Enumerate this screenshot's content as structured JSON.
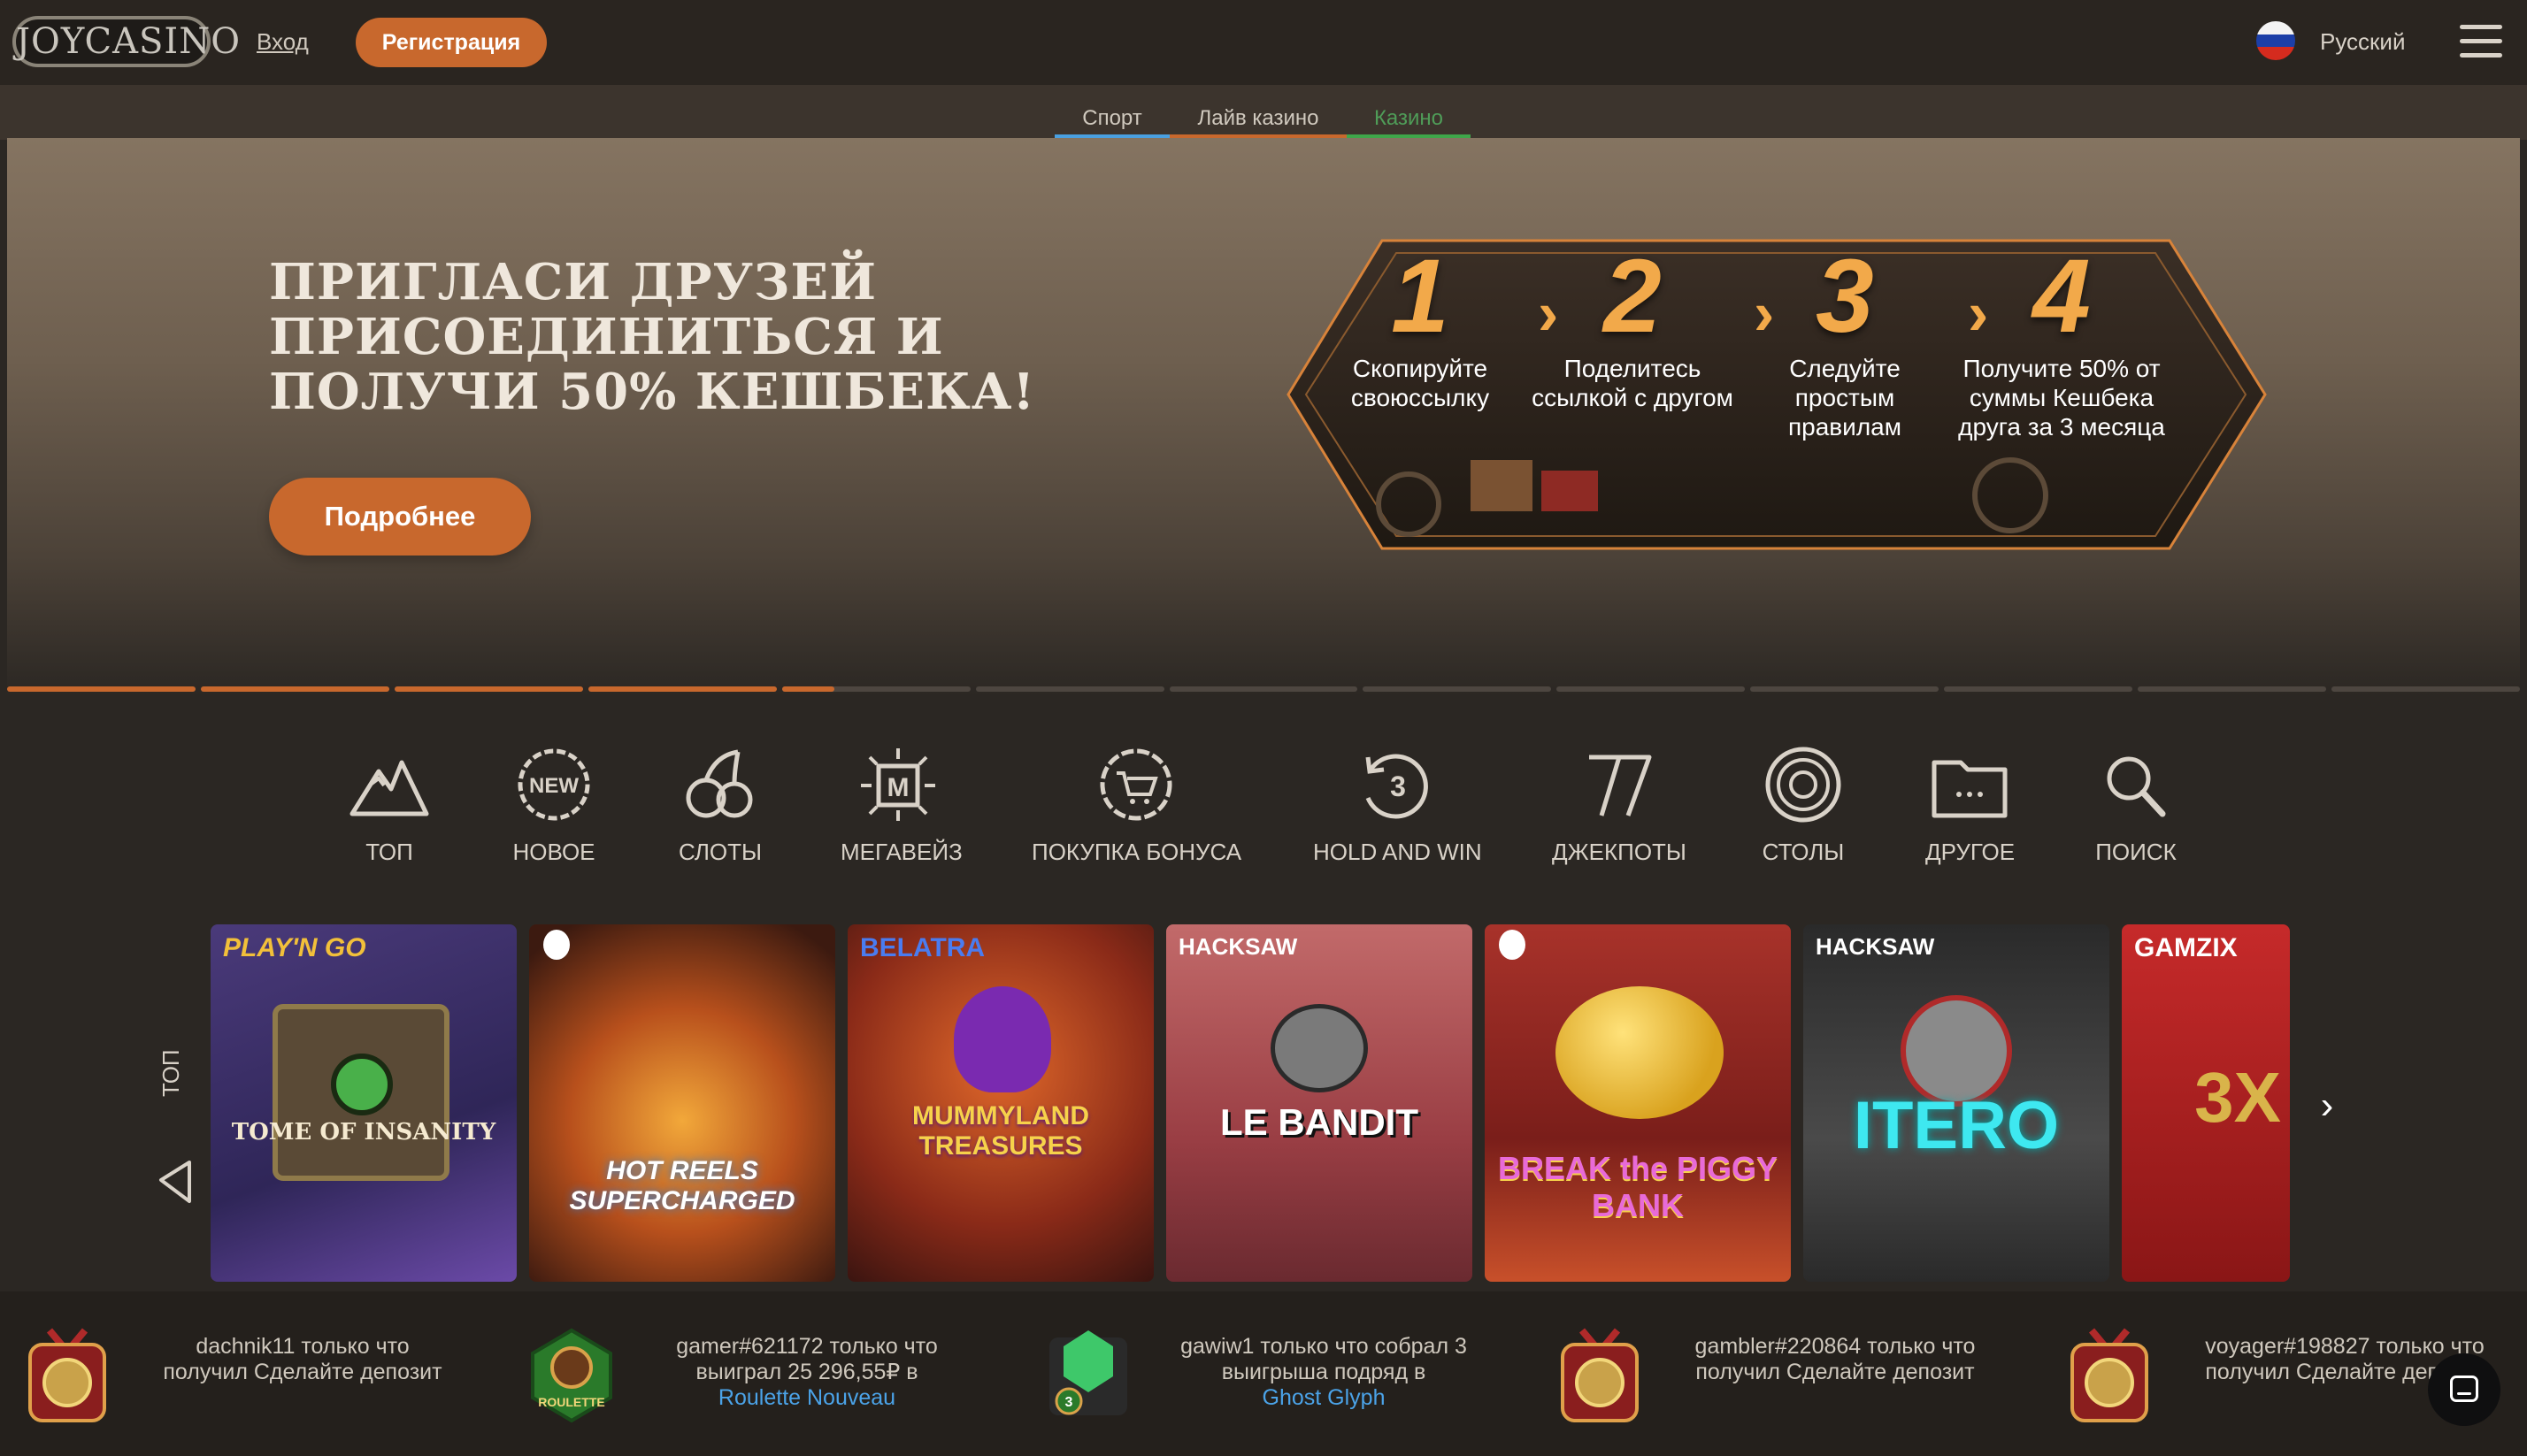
{
  "header": {
    "logo_text": "JOYCASINO",
    "login_label": "Вход",
    "register_label": "Регистрация",
    "language": "Русский"
  },
  "subnav": {
    "tabs": [
      {
        "label": "Спорт",
        "color": "#4aa0e0"
      },
      {
        "label": "Лайв казино",
        "color": "#c8682d"
      },
      {
        "label": "Казино",
        "color": "#3fa64a"
      }
    ]
  },
  "banner": {
    "title": "ПРИГЛАСИ ДРУЗЕЙ ПРИСОЕДИНИТЬСЯ И ПОЛУЧИ 50% КЕШБЕКА!",
    "button_label": "Подробнее",
    "steps": [
      {
        "num": "1",
        "text": "Скопируйте своюссылку"
      },
      {
        "num": "2",
        "text": "Поделитесь ссылкой с другом"
      },
      {
        "num": "3",
        "text": "Следуйте простым правилам"
      },
      {
        "num": "4",
        "text": "Получите 50% от суммы Кешбека друга за 3 месяца"
      }
    ],
    "slides_total": 13,
    "active_slide": 4
  },
  "categories": [
    {
      "label": "ТОП",
      "icon": "mountain-icon"
    },
    {
      "label": "НОВОЕ",
      "icon": "new-badge-icon"
    },
    {
      "label": "СЛОТЫ",
      "icon": "cherries-icon"
    },
    {
      "label": "МЕГАВЕЙЗ",
      "icon": "megaways-icon"
    },
    {
      "label": "ПОКУПКА БОНУСА",
      "icon": "bonus-cart-icon"
    },
    {
      "label": "HOLD AND WIN",
      "icon": "hold-and-win-icon"
    },
    {
      "label": "ДЖЕКПОТЫ",
      "icon": "seven-icon"
    },
    {
      "label": "СТОЛЫ",
      "icon": "roulette-icon"
    },
    {
      "label": "ДРУГОЕ",
      "icon": "folder-icon"
    },
    {
      "label": "ПОИСК",
      "icon": "search-icon"
    }
  ],
  "games_section": {
    "label": "ТОП",
    "games": [
      {
        "provider": "PLAY'N GO",
        "name": "TOME OF INSANITY"
      },
      {
        "provider": "",
        "name": "HOT REELS SUPERCHARGED"
      },
      {
        "provider": "BELATRA",
        "name": "MUMMYLAND TREASURES"
      },
      {
        "provider": "HACKSAW",
        "name": "LE BANDIT"
      },
      {
        "provider": "",
        "name": "BREAK the PIGGY BANK"
      },
      {
        "provider": "HACKSAW",
        "name": "ITERO"
      },
      {
        "provider": "GAMZIX",
        "name": "3X"
      }
    ]
  },
  "feed": [
    {
      "text": "dachnik11 только что получил Сделайте депозит",
      "link": ""
    },
    {
      "text": "gamer#621172 только что выиграл 25 296,55₽ в",
      "link": "Roulette Nouveau"
    },
    {
      "text": "gawiw1 только что собрал 3 выигрыша подряд в",
      "link": "Ghost Glyph"
    },
    {
      "text": "gambler#220864 только что получил Сделайте депозит",
      "link": ""
    },
    {
      "text": "voyager#198827 только что получил Сделайте депозит",
      "link": ""
    }
  ]
}
